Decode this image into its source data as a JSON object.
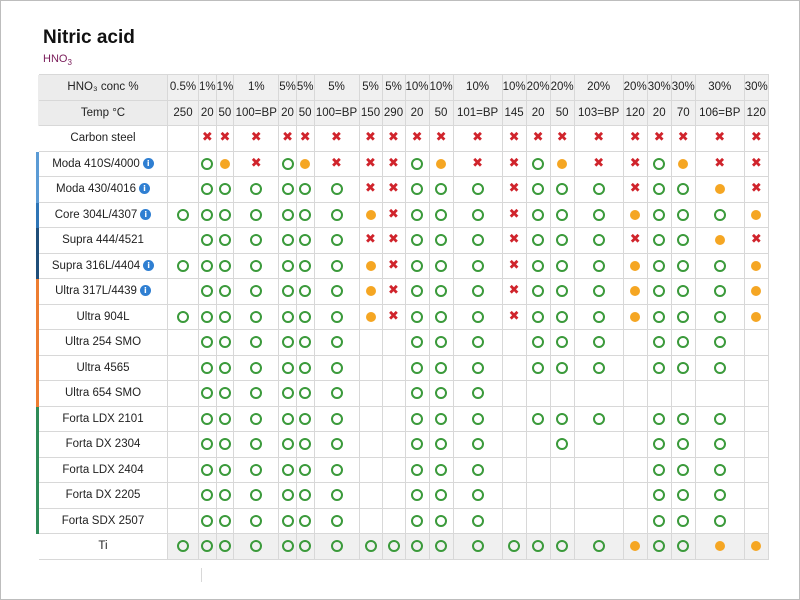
{
  "title": "Nitric acid",
  "subtitle": {
    "base": "HNO",
    "sub": "3"
  },
  "header": {
    "conc_label": "HNO₃ conc %",
    "temp_label": "Temp °C",
    "conc": [
      "0.5%",
      "1%",
      "1%",
      "1%",
      "5%",
      "5%",
      "5%",
      "5%",
      "5%",
      "10%",
      "10%",
      "10%",
      "10%",
      "20%",
      "20%",
      "20%",
      "20%",
      "30%",
      "30%",
      "30%",
      "30%"
    ],
    "temp": [
      "250",
      "20",
      "50",
      "100=BP",
      "20",
      "50",
      "100=BP",
      "150",
      "290",
      "20",
      "50",
      "101=BP",
      "145",
      "20",
      "50",
      "103=BP",
      "120",
      "20",
      "70",
      "106=BP",
      "120"
    ]
  },
  "legend": {
    "o": "resistant-icon",
    "d": "partially-resistant-icon",
    "x": "not-resistant-icon",
    "": "empty"
  },
  "colors": {
    "resistant": "#3b9a3b",
    "partial": "#f5a623",
    "not_resistant": "#d0242c",
    "info": "#2f7fd2"
  },
  "rows": [
    {
      "name": "Carbon steel",
      "info": false,
      "accent": "",
      "cells": [
        "",
        "x",
        "x",
        "x",
        "x",
        "x",
        "x",
        "x",
        "x",
        "x",
        "x",
        "x",
        "x",
        "x",
        "x",
        "x",
        "x",
        "x",
        "x",
        "x",
        "x"
      ]
    },
    {
      "name": "Moda 410S/4000",
      "info": true,
      "accent": "#5b9bd5",
      "cells": [
        "",
        "o",
        "d",
        "x",
        "o",
        "d",
        "x",
        "x",
        "x",
        "o",
        "d",
        "x",
        "x",
        "o",
        "d",
        "x",
        "x",
        "o",
        "d",
        "x",
        "x"
      ]
    },
    {
      "name": "Moda 430/4016",
      "info": true,
      "accent": "#5b9bd5",
      "cells": [
        "",
        "o",
        "o",
        "o",
        "o",
        "o",
        "o",
        "x",
        "x",
        "o",
        "o",
        "o",
        "x",
        "o",
        "o",
        "o",
        "x",
        "o",
        "o",
        "d",
        "x"
      ]
    },
    {
      "name": "Core 304L/4307",
      "info": true,
      "accent": "#2e75b6",
      "cells": [
        "o",
        "o",
        "o",
        "o",
        "o",
        "o",
        "o",
        "d",
        "x",
        "o",
        "o",
        "o",
        "x",
        "o",
        "o",
        "o",
        "d",
        "o",
        "o",
        "o",
        "d"
      ]
    },
    {
      "name": "Supra 444/4521",
      "info": false,
      "accent": "#1f4e79",
      "cells": [
        "",
        "o",
        "o",
        "o",
        "o",
        "o",
        "o",
        "x",
        "x",
        "o",
        "o",
        "o",
        "x",
        "o",
        "o",
        "o",
        "x",
        "o",
        "o",
        "d",
        "x"
      ]
    },
    {
      "name": "Supra 316L/4404",
      "info": true,
      "accent": "#1f4e79",
      "cells": [
        "o",
        "o",
        "o",
        "o",
        "o",
        "o",
        "o",
        "d",
        "x",
        "o",
        "o",
        "o",
        "x",
        "o",
        "o",
        "o",
        "d",
        "o",
        "o",
        "o",
        "d"
      ]
    },
    {
      "name": "Ultra 317L/4439",
      "info": true,
      "accent": "#ed7d31",
      "cells": [
        "",
        "o",
        "o",
        "o",
        "o",
        "o",
        "o",
        "d",
        "x",
        "o",
        "o",
        "o",
        "x",
        "o",
        "o",
        "o",
        "d",
        "o",
        "o",
        "o",
        "d"
      ]
    },
    {
      "name": "Ultra 904L",
      "info": false,
      "accent": "#ed7d31",
      "cells": [
        "o",
        "o",
        "o",
        "o",
        "o",
        "o",
        "o",
        "d",
        "x",
        "o",
        "o",
        "o",
        "x",
        "o",
        "o",
        "o",
        "d",
        "o",
        "o",
        "o",
        "d"
      ]
    },
    {
      "name": "Ultra 254 SMO",
      "info": false,
      "accent": "#ed7d31",
      "cells": [
        "",
        "o",
        "o",
        "o",
        "o",
        "o",
        "o",
        "",
        "",
        "o",
        "o",
        "o",
        "",
        "o",
        "o",
        "o",
        "",
        "o",
        "o",
        "o",
        ""
      ]
    },
    {
      "name": "Ultra 4565",
      "info": false,
      "accent": "#ed7d31",
      "cells": [
        "",
        "o",
        "o",
        "o",
        "o",
        "o",
        "o",
        "",
        "",
        "o",
        "o",
        "o",
        "",
        "o",
        "o",
        "o",
        "",
        "o",
        "o",
        "o",
        ""
      ]
    },
    {
      "name": "Ultra 654 SMO",
      "info": false,
      "accent": "#ed7d31",
      "cells": [
        "",
        "o",
        "o",
        "o",
        "o",
        "o",
        "o",
        "",
        "",
        "o",
        "o",
        "o",
        "",
        "",
        "",
        "",
        "",
        "",
        "",
        "",
        ""
      ]
    },
    {
      "name": "Forta LDX 2101",
      "info": false,
      "accent": "#2e8b57",
      "cells": [
        "",
        "o",
        "o",
        "o",
        "o",
        "o",
        "o",
        "",
        "",
        "o",
        "o",
        "o",
        "",
        "o",
        "o",
        "o",
        "",
        "o",
        "o",
        "o",
        ""
      ]
    },
    {
      "name": "Forta DX 2304",
      "info": false,
      "accent": "#2e8b57",
      "cells": [
        "",
        "o",
        "o",
        "o",
        "o",
        "o",
        "o",
        "",
        "",
        "o",
        "o",
        "o",
        "",
        "",
        "o",
        "",
        "",
        "o",
        "o",
        "o",
        ""
      ]
    },
    {
      "name": "Forta LDX 2404",
      "info": false,
      "accent": "#2e8b57",
      "cells": [
        "",
        "o",
        "o",
        "o",
        "o",
        "o",
        "o",
        "",
        "",
        "o",
        "o",
        "o",
        "",
        "",
        "",
        "",
        "",
        "o",
        "o",
        "o",
        ""
      ]
    },
    {
      "name": "Forta DX 2205",
      "info": false,
      "accent": "#2e8b57",
      "cells": [
        "",
        "o",
        "o",
        "o",
        "o",
        "o",
        "o",
        "",
        "",
        "o",
        "o",
        "o",
        "",
        "",
        "",
        "",
        "",
        "o",
        "o",
        "o",
        ""
      ]
    },
    {
      "name": "Forta SDX 2507",
      "info": false,
      "accent": "#2e8b57",
      "cells": [
        "",
        "o",
        "o",
        "o",
        "o",
        "o",
        "o",
        "",
        "",
        "o",
        "o",
        "o",
        "",
        "",
        "",
        "",
        "",
        "o",
        "o",
        "o",
        ""
      ]
    },
    {
      "name": "Ti",
      "info": false,
      "accent": "",
      "cells": [
        "o",
        "o",
        "o",
        "o",
        "o",
        "o",
        "o",
        "o",
        "o",
        "o",
        "o",
        "o",
        "o",
        "o",
        "o",
        "o",
        "d",
        "o",
        "o",
        "d",
        "d"
      ]
    }
  ]
}
